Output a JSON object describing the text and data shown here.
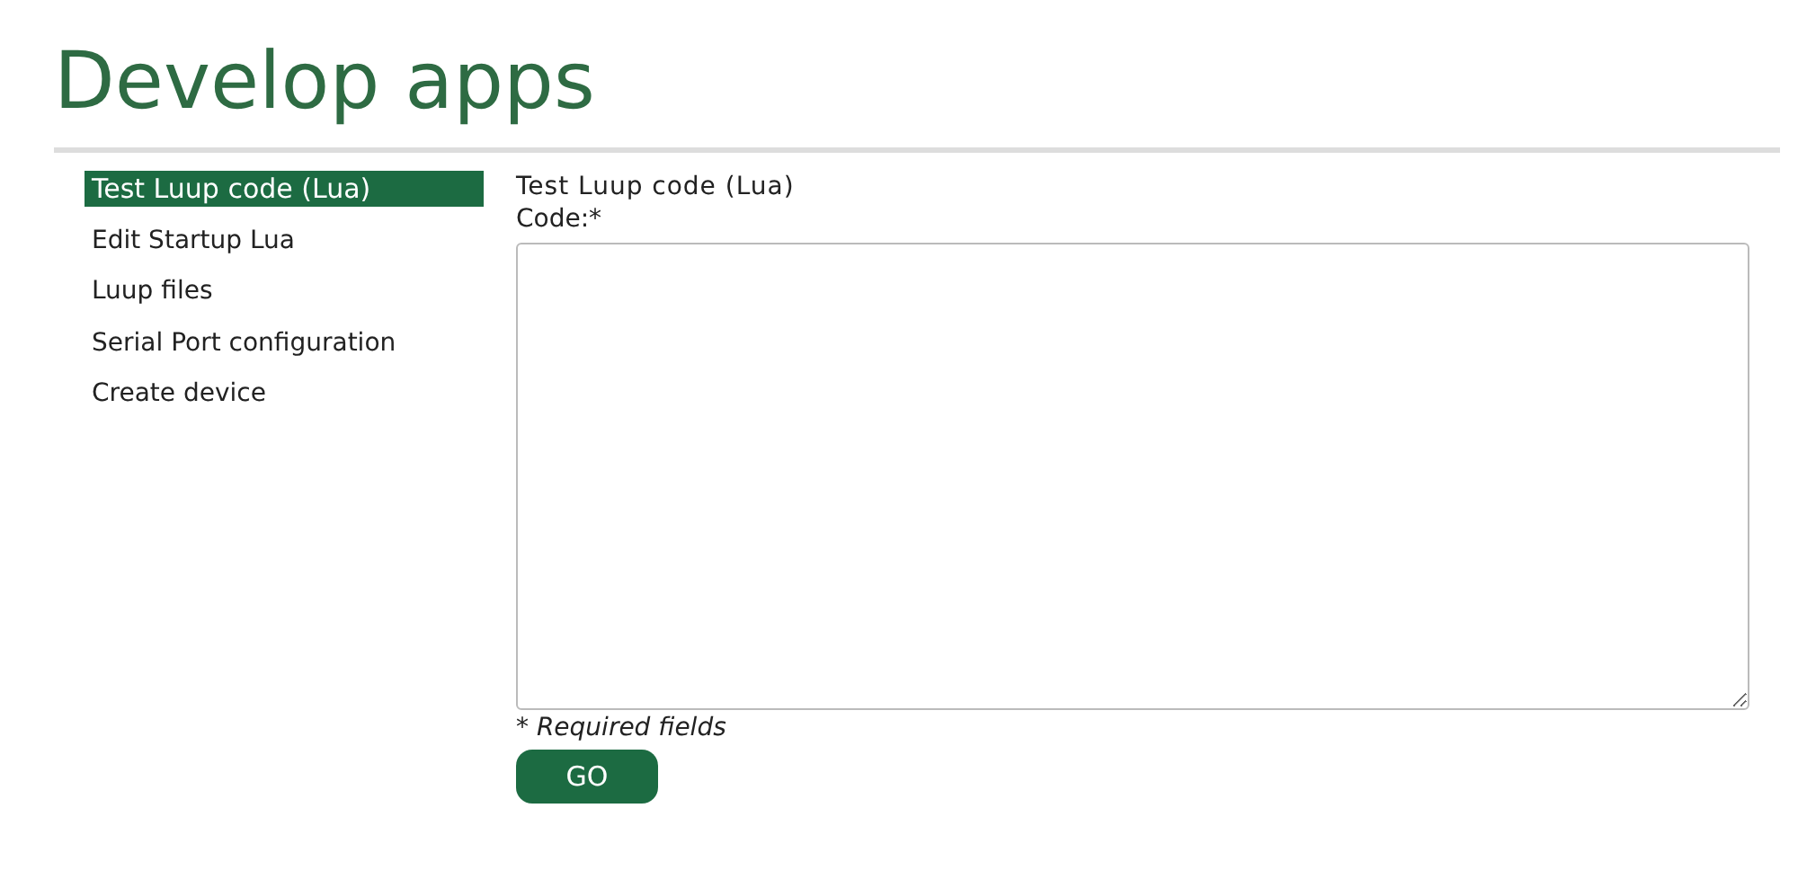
{
  "page_title": "Develop apps",
  "sidebar": {
    "items": [
      {
        "label": "Test Luup code (Lua)",
        "selected": true
      },
      {
        "label": "Edit Startup Lua",
        "selected": false
      },
      {
        "label": "Luup files",
        "selected": false
      },
      {
        "label": "Serial Port configuration",
        "selected": false
      },
      {
        "label": "Create device",
        "selected": false
      }
    ]
  },
  "form": {
    "title": "Test Luup code (Lua)",
    "code_label": "Code:*",
    "required_note": "* Required fields",
    "submit": "GO"
  }
}
